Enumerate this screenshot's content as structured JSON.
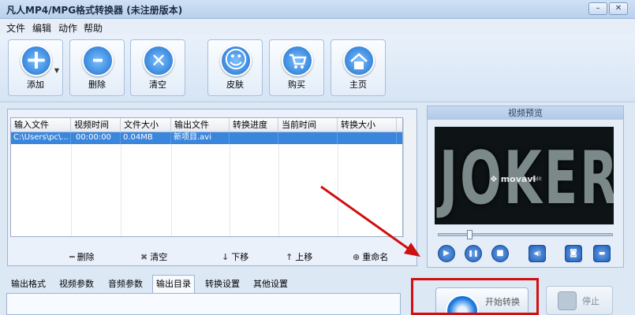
{
  "window": {
    "title": "凡人MP4/MPG格式转换器 (未注册版本)",
    "minimize": "–",
    "close": "✕"
  },
  "menu": [
    "文件",
    "编辑",
    "动作",
    "帮助"
  ],
  "toolbar": [
    {
      "label": "添加",
      "icon": "add-icon",
      "glyph": "+",
      "color": "#2f8fe0"
    },
    {
      "label": "删除",
      "icon": "remove-icon",
      "glyph": "–",
      "color": "#2f8fe0"
    },
    {
      "label": "清空",
      "icon": "clear-icon",
      "glyph": "✕",
      "color": "#2f8fe0"
    },
    {
      "label": "皮肤",
      "icon": "smiley-icon",
      "glyph": "☺",
      "color": "#2f8fe0"
    },
    {
      "label": "购买",
      "icon": "cart-icon",
      "glyph": "🛒",
      "color": "#2f8fe0"
    },
    {
      "label": "主页",
      "icon": "home-icon",
      "glyph": "⌂",
      "color": "#2f8fe0"
    }
  ],
  "grid": {
    "columns": [
      "输入文件",
      "视频时间",
      "文件大小",
      "输出文件",
      "转换进度",
      "当前时间",
      "转换大小"
    ],
    "rows": [
      [
        "C:\\Users\\pc\\...",
        "00:00:00",
        "0.04MB",
        "新项目.avi",
        "",
        "",
        ""
      ]
    ]
  },
  "grid_actions": [
    {
      "label": "删除",
      "icon": "minus-icon",
      "glyph": "━"
    },
    {
      "label": "清空",
      "icon": "x-icon",
      "glyph": "✖"
    },
    {
      "label": "下移",
      "icon": "arrow-down-icon",
      "glyph": "↓"
    },
    {
      "label": "上移",
      "icon": "arrow-up-icon",
      "glyph": "↑"
    },
    {
      "label": "重命名",
      "icon": "rename-icon",
      "glyph": "⊕"
    }
  ],
  "preview": {
    "title": "视频预览",
    "video_text": "JOKER",
    "watermark": "❖ movavi",
    "watermark_small": "Edit",
    "seek_position": 0.17
  },
  "player_controls": [
    {
      "name": "play-button",
      "glyph": "▶"
    },
    {
      "name": "pause-button",
      "glyph": "❚❚"
    },
    {
      "name": "stop-playback-button",
      "glyph": "■"
    },
    {
      "name": "volume-button",
      "glyph": "◀)"
    },
    {
      "name": "snapshot-button",
      "glyph": "◙"
    },
    {
      "name": "open-folder-button",
      "glyph": "▬"
    }
  ],
  "tabs": [
    "输出格式",
    "视频参数",
    "音频参数",
    "输出目录",
    "转换设置",
    "其他设置"
  ],
  "active_tab": "输出目录",
  "convert": {
    "label": "开始转换"
  },
  "stop": {
    "label": "停止"
  },
  "colors": {
    "accent": "#2f8fe0",
    "selection": "#3a86dd",
    "highlight_frame": "#d01010",
    "annotation_arrow": "#d01010"
  }
}
